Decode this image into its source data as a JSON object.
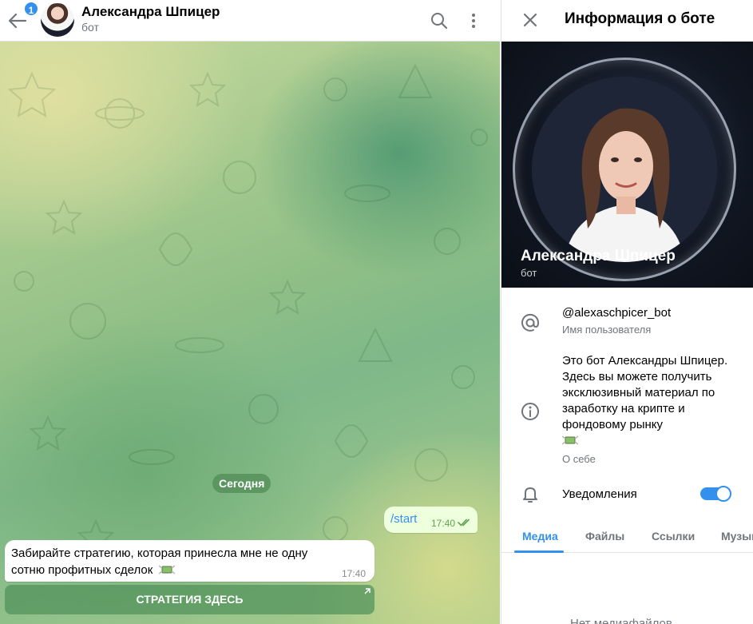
{
  "chat": {
    "unread_count": "1",
    "title": "Александра Шпицер",
    "subtitle": "бот",
    "date_separator": "Сегодня",
    "outgoing": {
      "text": "/start",
      "time": "17:40"
    },
    "incoming": {
      "text": "Забирайте стратегию, которая принесла мне не одну сотню профитных сделок",
      "emoji": "money-with-wings-icon",
      "time": "17:40"
    },
    "inline_button": "СТРАТЕГИЯ ЗДЕСЬ"
  },
  "panel": {
    "title": "Информация о боте",
    "name": "Александра Шпицер",
    "subtitle": "бот",
    "username": "@alexaschpicer_bot",
    "username_label": "Имя пользователя",
    "about": "Это бот Александры Шпицер. Здесь вы можете получить эксклюзивный материал по заработку на крипте и фондовому рынку",
    "about_label": "О себе",
    "notifications_label": "Уведомления",
    "notifications_on": true,
    "tabs": [
      "Медиа",
      "Файлы",
      "Ссылки",
      "Музыка"
    ],
    "active_tab": "Медиа",
    "empty_note": "Нет медиафайлов"
  },
  "colors": {
    "accent": "#3390ec",
    "outgoing_bubble": "#eeffde",
    "profile_bg": "#111722"
  }
}
